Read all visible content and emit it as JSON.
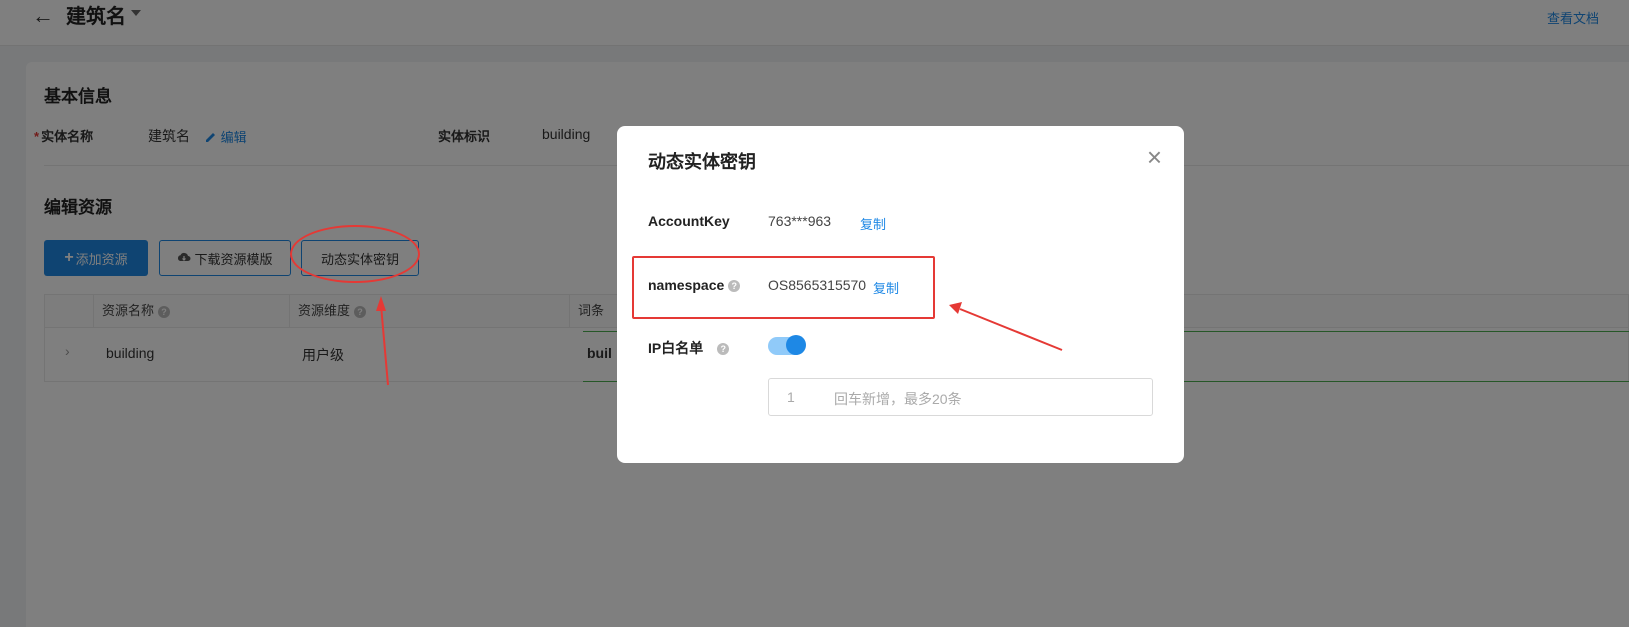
{
  "header": {
    "back": "←",
    "title": "建筑名",
    "doc_link": "查看文档"
  },
  "basic_info": {
    "section_title": "基本信息",
    "entity_name_label": "实体名称",
    "required_mark": "*",
    "entity_name_value": "建筑名",
    "edit_label": "编辑",
    "entity_id_label": "实体标识",
    "entity_id_value": "building"
  },
  "resources": {
    "section_title": "编辑资源",
    "add_button": "添加资源",
    "add_icon": "+",
    "download_button": "下载资源模版",
    "secret_button": "动态实体密钥",
    "columns": [
      "资源名称",
      "资源维度",
      "词条"
    ],
    "rows": [
      {
        "name": "building",
        "dimension": "用户级",
        "detail": "buil"
      }
    ]
  },
  "modal": {
    "title": "动态实体密钥",
    "close": "×",
    "account_key_label": "AccountKey",
    "account_key_value": "763***963",
    "copy_label": "复制",
    "namespace_label": "namespace",
    "namespace_value": "OS8565315570",
    "ip_whitelist_label": "IP白名单",
    "ip_whitelist_enabled": true,
    "ip_input_index": "1",
    "ip_input_placeholder": "回车新增，最多20条"
  },
  "colors": {
    "accent": "#1e88e5",
    "annotation": "#e53935"
  }
}
